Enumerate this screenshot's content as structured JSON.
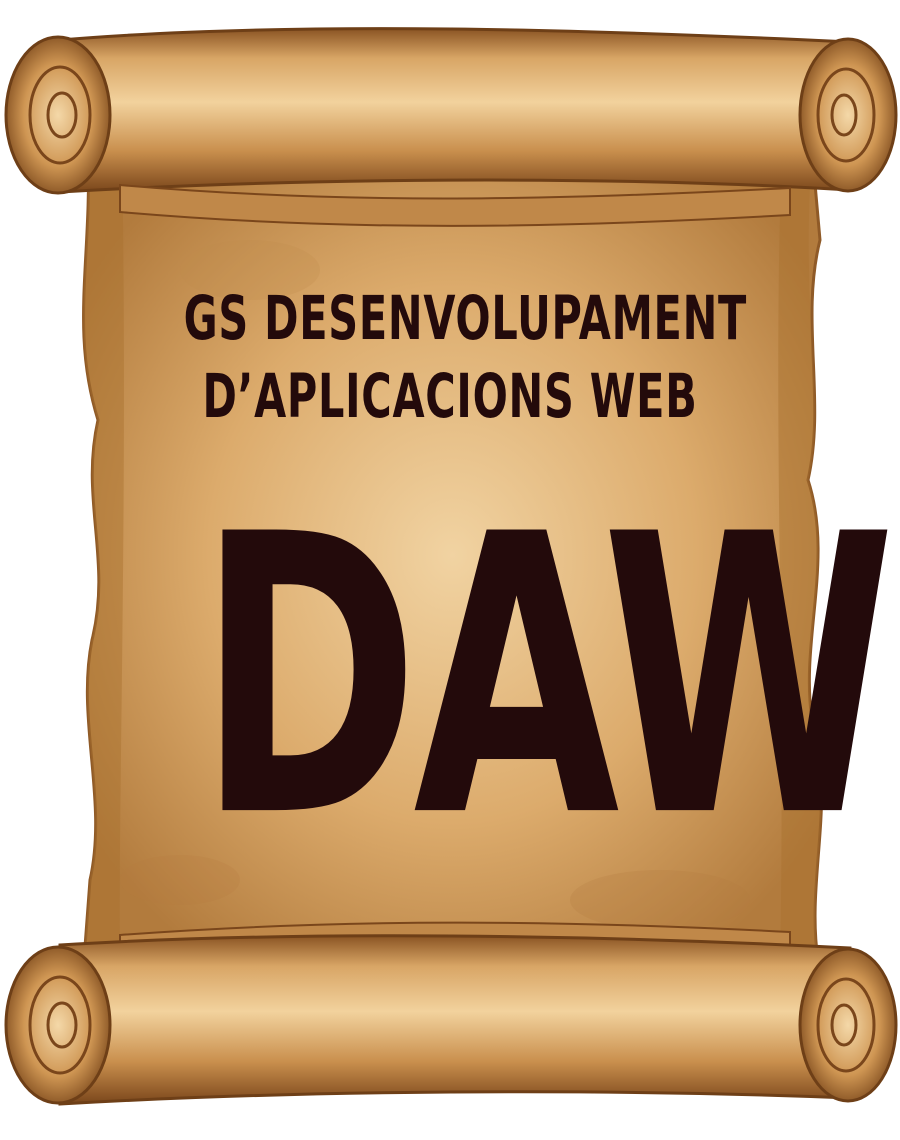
{
  "scroll": {
    "line1": "GS DESENVOLUPAMENT",
    "line2": "D’APLICACIONS WEB",
    "acronym": "DAW"
  },
  "colors": {
    "parchment_light": "#e8c48e",
    "parchment_mid": "#d19e5c",
    "parchment_dark": "#9a6430",
    "roll_edge": "#6e3f17",
    "text": "#230a0b"
  },
  "icons": [
    "parchment-scroll-icon"
  ]
}
